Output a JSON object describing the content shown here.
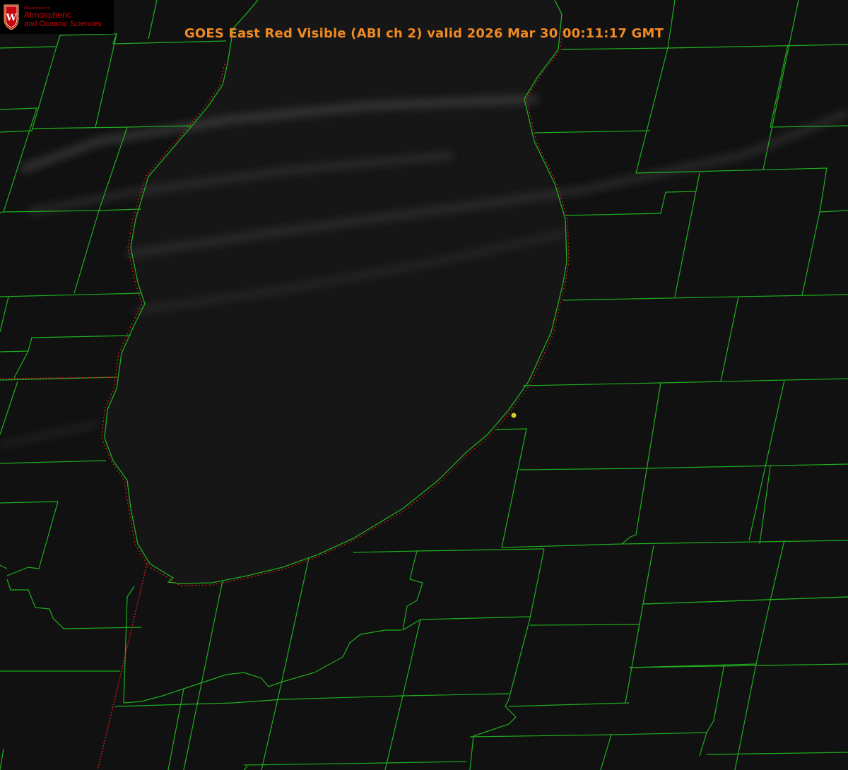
{
  "title": "GOES East Red Visible (ABI ch 2) valid 2026 Mar 30 00:11:17 GMT",
  "logo": {
    "dept_line": "Department of",
    "line1": "Atmospheric",
    "line2": "and Oceanic Sciences",
    "crest_letter": "W"
  },
  "colors": {
    "background": "#111111",
    "lake": "#161616",
    "county_lines": "#1fae1f",
    "state_line": "#d81f1f",
    "title": "#f08a24",
    "logo": "#c5050c",
    "station_marker": "#d8cc2a"
  },
  "markers": [
    {
      "name": "station-marker",
      "kind": "dot"
    }
  ],
  "layers": [
    "county-boundaries",
    "state-boundaries",
    "lake-shoreline",
    "cloud-streaks"
  ]
}
